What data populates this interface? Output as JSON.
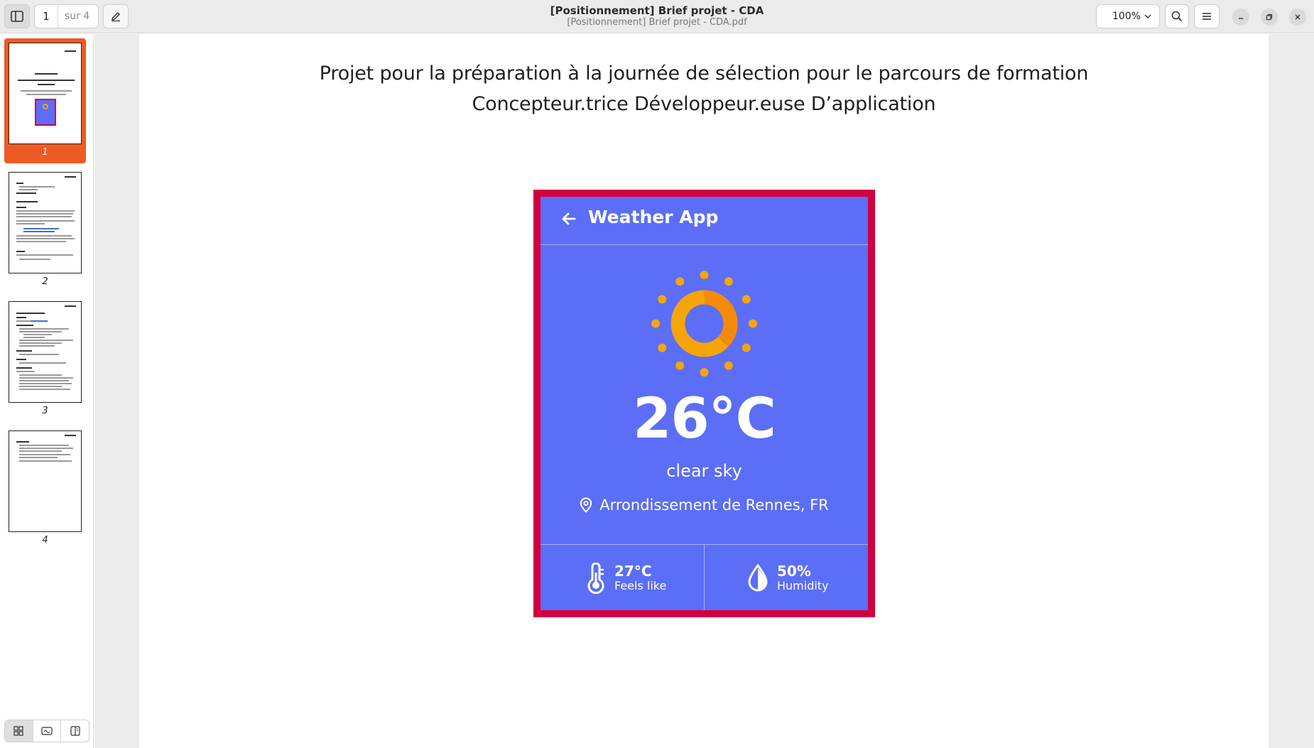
{
  "header": {
    "title": "[Positionnement] Brief projet - CDA",
    "subtitle": "[Positionnement] Brief projet - CDA.pdf",
    "page_current": "1",
    "page_total": "sur 4",
    "zoom": "100%"
  },
  "sidebar": {
    "thumbnails": [
      {
        "number": "1",
        "selected": true
      },
      {
        "number": "2",
        "selected": false
      },
      {
        "number": "3",
        "selected": false
      },
      {
        "number": "4",
        "selected": false
      }
    ]
  },
  "document": {
    "heading_line1": "Projet pour la préparation à la journée de sélection pour le parcours de formation",
    "heading_line2": "Concepteur.trice Développeur.euse D’application"
  },
  "weather_app": {
    "title": "Weather App",
    "temperature": "26°C",
    "description": "clear sky",
    "location": "Arrondissement de Rennes, FR",
    "feels_like_value": "27°C",
    "feels_like_label": "Feels like",
    "humidity_value": "50%",
    "humidity_label": "Humidity",
    "colors": {
      "frame": "#d1003f",
      "background": "#5b6ef5",
      "sun": "#f5a50a"
    }
  },
  "colors": {
    "accent": "#ee5a24"
  }
}
